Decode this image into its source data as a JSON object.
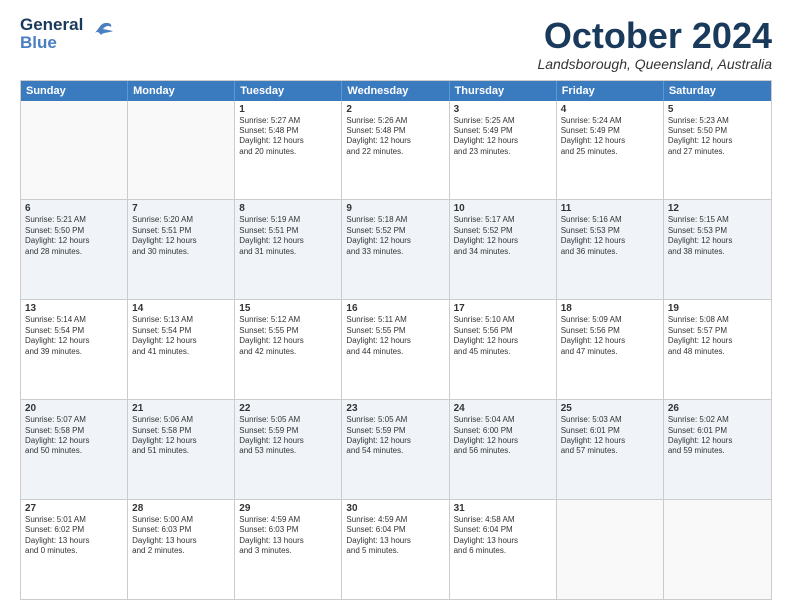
{
  "logo": {
    "line1": "General",
    "line2": "Blue"
  },
  "title": "October 2024",
  "location": "Landsborough, Queensland, Australia",
  "headers": [
    "Sunday",
    "Monday",
    "Tuesday",
    "Wednesday",
    "Thursday",
    "Friday",
    "Saturday"
  ],
  "rows": [
    [
      {
        "day": "",
        "text": ""
      },
      {
        "day": "",
        "text": ""
      },
      {
        "day": "1",
        "text": "Sunrise: 5:27 AM\nSunset: 5:48 PM\nDaylight: 12 hours\nand 20 minutes."
      },
      {
        "day": "2",
        "text": "Sunrise: 5:26 AM\nSunset: 5:48 PM\nDaylight: 12 hours\nand 22 minutes."
      },
      {
        "day": "3",
        "text": "Sunrise: 5:25 AM\nSunset: 5:49 PM\nDaylight: 12 hours\nand 23 minutes."
      },
      {
        "day": "4",
        "text": "Sunrise: 5:24 AM\nSunset: 5:49 PM\nDaylight: 12 hours\nand 25 minutes."
      },
      {
        "day": "5",
        "text": "Sunrise: 5:23 AM\nSunset: 5:50 PM\nDaylight: 12 hours\nand 27 minutes."
      }
    ],
    [
      {
        "day": "6",
        "text": "Sunrise: 5:21 AM\nSunset: 5:50 PM\nDaylight: 12 hours\nand 28 minutes."
      },
      {
        "day": "7",
        "text": "Sunrise: 5:20 AM\nSunset: 5:51 PM\nDaylight: 12 hours\nand 30 minutes."
      },
      {
        "day": "8",
        "text": "Sunrise: 5:19 AM\nSunset: 5:51 PM\nDaylight: 12 hours\nand 31 minutes."
      },
      {
        "day": "9",
        "text": "Sunrise: 5:18 AM\nSunset: 5:52 PM\nDaylight: 12 hours\nand 33 minutes."
      },
      {
        "day": "10",
        "text": "Sunrise: 5:17 AM\nSunset: 5:52 PM\nDaylight: 12 hours\nand 34 minutes."
      },
      {
        "day": "11",
        "text": "Sunrise: 5:16 AM\nSunset: 5:53 PM\nDaylight: 12 hours\nand 36 minutes."
      },
      {
        "day": "12",
        "text": "Sunrise: 5:15 AM\nSunset: 5:53 PM\nDaylight: 12 hours\nand 38 minutes."
      }
    ],
    [
      {
        "day": "13",
        "text": "Sunrise: 5:14 AM\nSunset: 5:54 PM\nDaylight: 12 hours\nand 39 minutes."
      },
      {
        "day": "14",
        "text": "Sunrise: 5:13 AM\nSunset: 5:54 PM\nDaylight: 12 hours\nand 41 minutes."
      },
      {
        "day": "15",
        "text": "Sunrise: 5:12 AM\nSunset: 5:55 PM\nDaylight: 12 hours\nand 42 minutes."
      },
      {
        "day": "16",
        "text": "Sunrise: 5:11 AM\nSunset: 5:55 PM\nDaylight: 12 hours\nand 44 minutes."
      },
      {
        "day": "17",
        "text": "Sunrise: 5:10 AM\nSunset: 5:56 PM\nDaylight: 12 hours\nand 45 minutes."
      },
      {
        "day": "18",
        "text": "Sunrise: 5:09 AM\nSunset: 5:56 PM\nDaylight: 12 hours\nand 47 minutes."
      },
      {
        "day": "19",
        "text": "Sunrise: 5:08 AM\nSunset: 5:57 PM\nDaylight: 12 hours\nand 48 minutes."
      }
    ],
    [
      {
        "day": "20",
        "text": "Sunrise: 5:07 AM\nSunset: 5:58 PM\nDaylight: 12 hours\nand 50 minutes."
      },
      {
        "day": "21",
        "text": "Sunrise: 5:06 AM\nSunset: 5:58 PM\nDaylight: 12 hours\nand 51 minutes."
      },
      {
        "day": "22",
        "text": "Sunrise: 5:05 AM\nSunset: 5:59 PM\nDaylight: 12 hours\nand 53 minutes."
      },
      {
        "day": "23",
        "text": "Sunrise: 5:05 AM\nSunset: 5:59 PM\nDaylight: 12 hours\nand 54 minutes."
      },
      {
        "day": "24",
        "text": "Sunrise: 5:04 AM\nSunset: 6:00 PM\nDaylight: 12 hours\nand 56 minutes."
      },
      {
        "day": "25",
        "text": "Sunrise: 5:03 AM\nSunset: 6:01 PM\nDaylight: 12 hours\nand 57 minutes."
      },
      {
        "day": "26",
        "text": "Sunrise: 5:02 AM\nSunset: 6:01 PM\nDaylight: 12 hours\nand 59 minutes."
      }
    ],
    [
      {
        "day": "27",
        "text": "Sunrise: 5:01 AM\nSunset: 6:02 PM\nDaylight: 13 hours\nand 0 minutes."
      },
      {
        "day": "28",
        "text": "Sunrise: 5:00 AM\nSunset: 6:03 PM\nDaylight: 13 hours\nand 2 minutes."
      },
      {
        "day": "29",
        "text": "Sunrise: 4:59 AM\nSunset: 6:03 PM\nDaylight: 13 hours\nand 3 minutes."
      },
      {
        "day": "30",
        "text": "Sunrise: 4:59 AM\nSunset: 6:04 PM\nDaylight: 13 hours\nand 5 minutes."
      },
      {
        "day": "31",
        "text": "Sunrise: 4:58 AM\nSunset: 6:04 PM\nDaylight: 13 hours\nand 6 minutes."
      },
      {
        "day": "",
        "text": ""
      },
      {
        "day": "",
        "text": ""
      }
    ]
  ]
}
